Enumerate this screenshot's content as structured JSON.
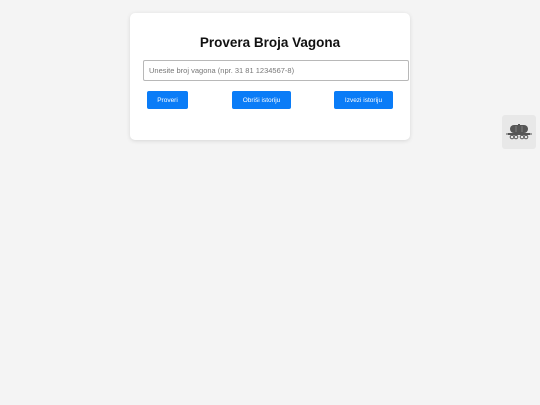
{
  "form": {
    "title": "Provera Broja Vagona",
    "input_placeholder": "Unesite broj vagona (npr. 31 81 1234567-8)",
    "input_value": "",
    "check_label": "Proveri",
    "clear_history_label": "Obriši istoriju",
    "export_history_label": "Izvezi istoriju"
  },
  "side_widget": {
    "icon": "tank-wagon-icon"
  },
  "colors": {
    "background": "#f4f4f4",
    "card": "#ffffff",
    "primary_button": "#0a7cf7",
    "button_text": "#ffffff"
  }
}
